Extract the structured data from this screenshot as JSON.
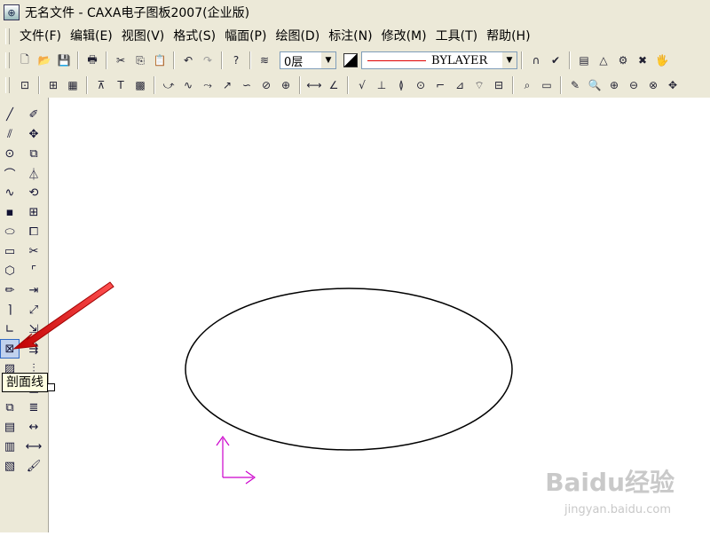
{
  "window": {
    "title": "无名文件 - CAXA电子图板2007(企业版)",
    "icon": "caxa-app-icon"
  },
  "menubar": {
    "items": [
      {
        "label": "文件(F)"
      },
      {
        "label": "编辑(E)"
      },
      {
        "label": "视图(V)"
      },
      {
        "label": "格式(S)"
      },
      {
        "label": "幅面(P)"
      },
      {
        "label": "绘图(D)"
      },
      {
        "label": "标注(N)"
      },
      {
        "label": "修改(M)"
      },
      {
        "label": "工具(T)"
      },
      {
        "label": "帮助(H)"
      }
    ]
  },
  "toolbar": {
    "layer_value": "0层",
    "linetype_value": "BYLAYER",
    "linetype_color": "#e00000"
  },
  "tooltip": {
    "text": "剖面线"
  },
  "watermark": {
    "logo_text": "Baidu经验",
    "url_text": "jingyan.baidu.com"
  },
  "colors": {
    "ucs_axis": "#cc00cc",
    "arrow": "#e01010"
  }
}
